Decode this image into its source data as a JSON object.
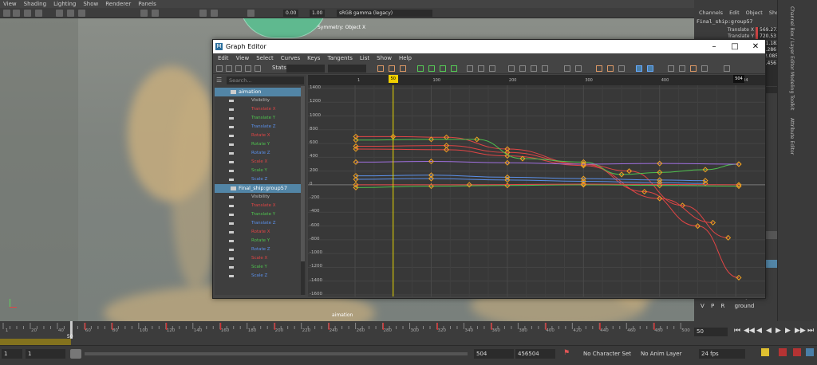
{
  "top_menu": [
    "View",
    "Shading",
    "Lighting",
    "Show",
    "Renderer",
    "Panels"
  ],
  "toolbar": {
    "num1": "0.00",
    "num2": "1.00",
    "colorspace": "sRGB gamma (legacy)"
  },
  "viewport": {
    "symmetry_label": "Symmetry: Object X",
    "object_label": "aimation"
  },
  "channel_box": {
    "menu": [
      "Channels",
      "Edit",
      "Object",
      "Show"
    ],
    "object_name": "Final_ship:group57",
    "channels": [
      {
        "name": "Translate X",
        "value": "569.273"
      },
      {
        "name": "Translate Y",
        "value": "720.53"
      },
      {
        "name": "Translate Z",
        "value": "111.183"
      },
      {
        "name": "Rotate X",
        "value": "58.286"
      },
      {
        "name": "Rotate Y",
        "value": "-12.085"
      },
      {
        "name": "Rotate Z",
        "value": "78.456"
      },
      {
        "name": "Scale X",
        "value": "2"
      },
      {
        "name": "Scale Y",
        "value": "2"
      },
      {
        "name": "Scale Z",
        "value": "2"
      },
      {
        "name": "Visibility",
        "value": "on"
      }
    ],
    "side_tabs": [
      "Channel Box / Layer Editor",
      "Modeling Toolkit",
      "Attribute Editor"
    ]
  },
  "layers": [
    {
      "v": "V",
      "p": "P",
      "r": "R",
      "name": "sky",
      "color": "#3fbf9a"
    },
    {
      "v": "V",
      "p": "P",
      "r": "R",
      "name": "ground",
      "color": ""
    }
  ],
  "graph_editor": {
    "title": "Graph Editor",
    "menu": [
      "Edit",
      "View",
      "Select",
      "Curves",
      "Keys",
      "Tangents",
      "List",
      "Show",
      "Help"
    ],
    "stats_label": "Stats",
    "search_placeholder": "Search...",
    "outliner": [
      {
        "label": "aimation",
        "type": "head",
        "selected": true
      },
      {
        "label": "Visibility",
        "color": "#bbbbbb"
      },
      {
        "label": "Translate X",
        "color": "#e04545"
      },
      {
        "label": "Translate Y",
        "color": "#4ec24e"
      },
      {
        "label": "Translate Z",
        "color": "#5a8fe8"
      },
      {
        "label": "Rotate X",
        "color": "#e04545"
      },
      {
        "label": "Rotate Y",
        "color": "#4ec24e"
      },
      {
        "label": "Rotate Z",
        "color": "#5a8fe8"
      },
      {
        "label": "Scale X",
        "color": "#e04545"
      },
      {
        "label": "Scale Y",
        "color": "#4ec24e"
      },
      {
        "label": "Scale Z",
        "color": "#5a8fe8"
      },
      {
        "label": "Final_ship:group57",
        "type": "head",
        "selected": true
      },
      {
        "label": "Visibility",
        "color": "#bbbbbb"
      },
      {
        "label": "Translate X",
        "color": "#e04545"
      },
      {
        "label": "Translate Y",
        "color": "#4ec24e"
      },
      {
        "label": "Translate Z",
        "color": "#5a8fe8"
      },
      {
        "label": "Rotate X",
        "color": "#e04545"
      },
      {
        "label": "Rotate Y",
        "color": "#4ec24e"
      },
      {
        "label": "Rotate Z",
        "color": "#5a8fe8"
      },
      {
        "label": "Scale X",
        "color": "#e04545"
      },
      {
        "label": "Scale Y",
        "color": "#4ec24e"
      },
      {
        "label": "Scale Z",
        "color": "#5a8fe8"
      }
    ],
    "y_ticks": [
      "1400",
      "1200",
      "1000",
      "800",
      "600",
      "400",
      "200",
      "0",
      "-200",
      "-400",
      "-600",
      "-800",
      "-1000",
      "-1200",
      "-1400",
      "-1600"
    ],
    "x_ticks": [
      "1",
      "100",
      "200",
      "300",
      "400",
      "504"
    ],
    "current_frame": "50",
    "end_frame": "504"
  },
  "chart_data": {
    "type": "line",
    "x_range": [
      1,
      504
    ],
    "y_range": [
      -1600,
      1400
    ],
    "current_frame": 50,
    "series": [
      {
        "color": "#e04545",
        "points": [
          [
            1,
            700
          ],
          [
            50,
            700
          ],
          [
            120,
            690
          ],
          [
            200,
            520
          ],
          [
            300,
            300
          ],
          [
            380,
            -100
          ],
          [
            450,
            -600
          ],
          [
            504,
            -1350
          ]
        ]
      },
      {
        "color": "#e04545",
        "points": [
          [
            1,
            560
          ],
          [
            120,
            570
          ],
          [
            200,
            470
          ],
          [
            300,
            300
          ],
          [
            360,
            200
          ],
          [
            430,
            -300
          ],
          [
            490,
            -770
          ]
        ]
      },
      {
        "color": "#e04545",
        "points": [
          [
            1,
            520
          ],
          [
            120,
            510
          ],
          [
            200,
            420
          ],
          [
            300,
            280
          ],
          [
            400,
            -200
          ],
          [
            470,
            -550
          ]
        ]
      },
      {
        "color": "#4ec24e",
        "points": [
          [
            1,
            650
          ],
          [
            100,
            660
          ],
          [
            160,
            660
          ],
          [
            220,
            380
          ],
          [
            300,
            330
          ],
          [
            350,
            150
          ],
          [
            400,
            180
          ],
          [
            460,
            220
          ],
          [
            504,
            300
          ]
        ]
      },
      {
        "color": "#5a8fe8",
        "points": [
          [
            1,
            130
          ],
          [
            100,
            140
          ],
          [
            200,
            110
          ],
          [
            300,
            90
          ],
          [
            400,
            70
          ],
          [
            460,
            60
          ]
        ]
      },
      {
        "color": "#5a8fe8",
        "points": [
          [
            1,
            80
          ],
          [
            100,
            90
          ],
          [
            200,
            70
          ],
          [
            300,
            50
          ],
          [
            400,
            30
          ],
          [
            460,
            20
          ]
        ]
      },
      {
        "color": "#a070e0",
        "points": [
          [
            1,
            330
          ],
          [
            100,
            340
          ],
          [
            200,
            320
          ],
          [
            300,
            300
          ],
          [
            400,
            310
          ],
          [
            504,
            300
          ]
        ]
      },
      {
        "color": "#4ec24e",
        "points": [
          [
            1,
            -40
          ],
          [
            100,
            -20
          ],
          [
            200,
            -10
          ],
          [
            300,
            0
          ],
          [
            400,
            -10
          ],
          [
            504,
            -20
          ]
        ]
      },
      {
        "color": "#e04545",
        "points": [
          [
            1,
            0
          ],
          [
            150,
            0
          ],
          [
            300,
            10
          ],
          [
            504,
            0
          ]
        ]
      }
    ]
  },
  "time_slider": {
    "ticks": [
      "1",
      "20",
      "40",
      "60",
      "80",
      "100",
      "120",
      "140",
      "160",
      "180",
      "200",
      "220",
      "240",
      "260",
      "280",
      "300",
      "320",
      "340",
      "360",
      "380",
      "400",
      "420",
      "440",
      "460",
      "480",
      "500"
    ],
    "current": "50",
    "frame_box": "50"
  },
  "bottom_bar": {
    "start": "1",
    "start2": "1",
    "end": "504",
    "end2": "456504",
    "character_set": "No Character Set",
    "anim_layer": "No Anim Layer",
    "fps": "24 fps"
  }
}
